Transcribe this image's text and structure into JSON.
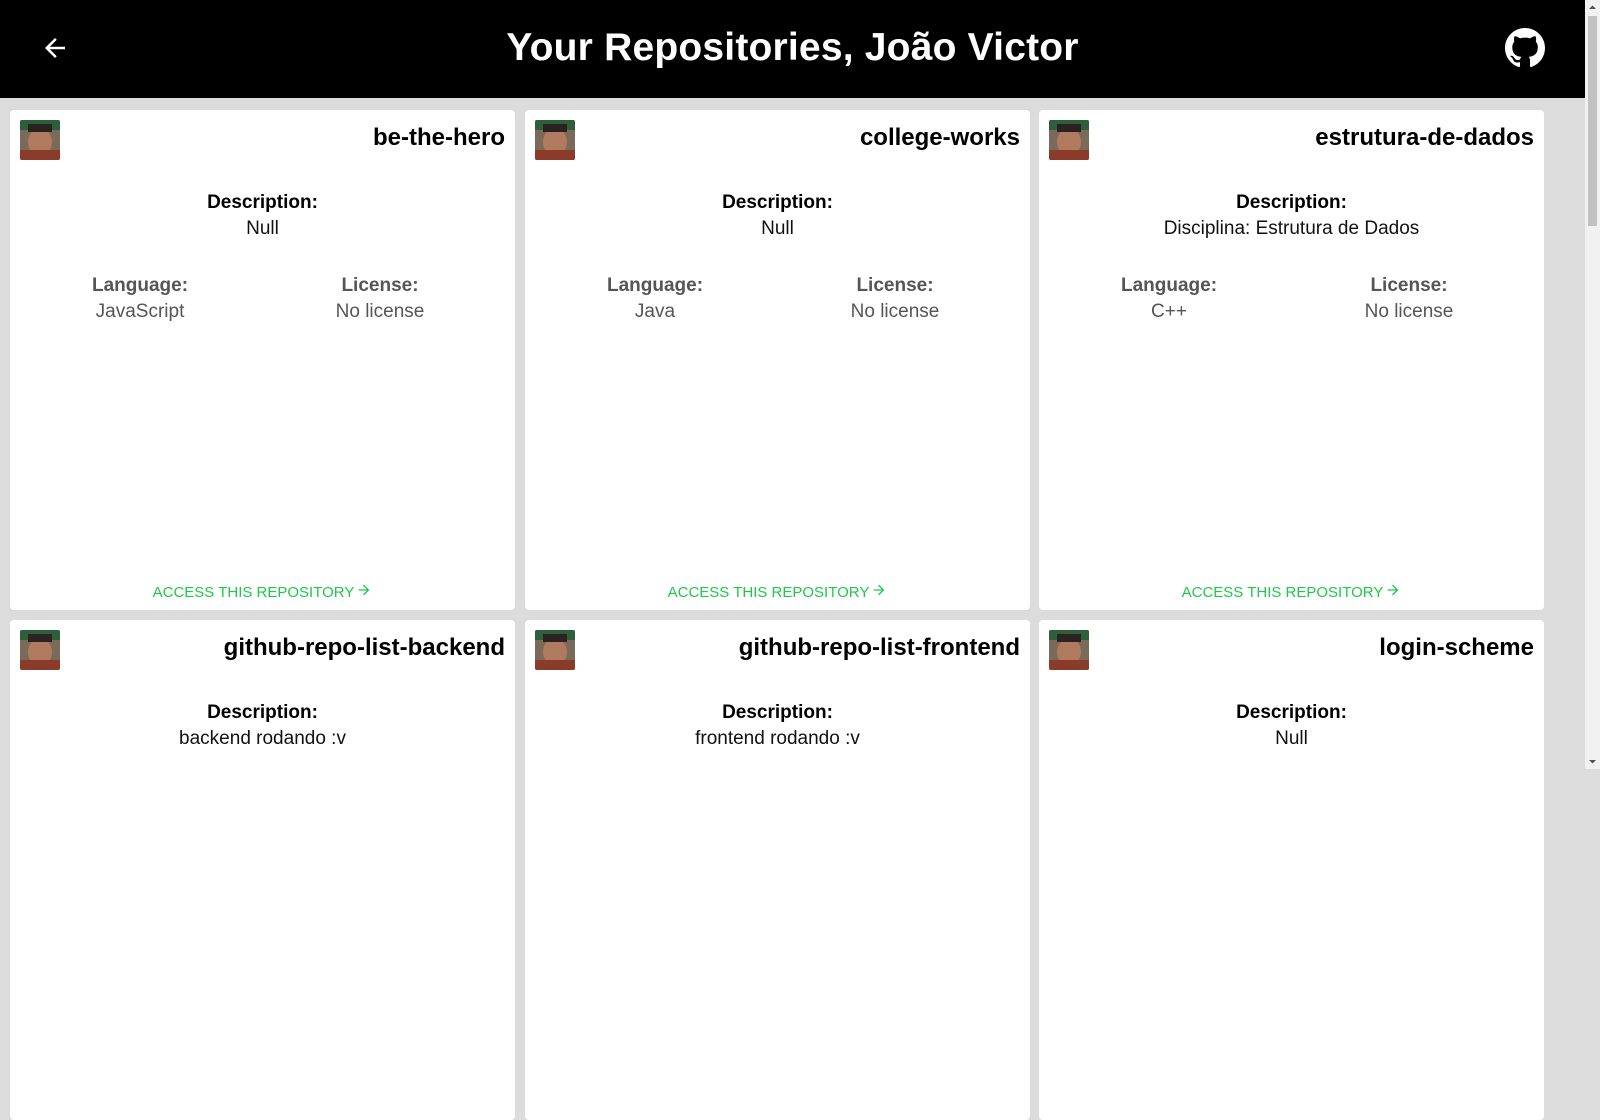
{
  "header": {
    "title": "Your Repositories, João Victor",
    "back_icon": "arrow-left-icon",
    "github_icon": "github-icon"
  },
  "access_label": "ACCESS THIS REPOSITORY",
  "labels": {
    "description": "Description:",
    "language": "Language:",
    "license": "License:"
  },
  "colors": {
    "topbar": "#000000",
    "background": "#dcdcdc",
    "accent": "#1ec94a"
  },
  "repos": [
    {
      "name": "be-the-hero",
      "description": "Null",
      "language": "JavaScript",
      "license": "No license"
    },
    {
      "name": "college-works",
      "description": "Null",
      "language": "Java",
      "license": "No license"
    },
    {
      "name": "estrutura-de-dados",
      "description": "Disciplina: Estrutura de Dados",
      "language": "C++",
      "license": "No license"
    },
    {
      "name": "github-repo-list-backend",
      "description": "backend rodando :v",
      "language": "",
      "license": ""
    },
    {
      "name": "github-repo-list-frontend",
      "description": "frontend rodando :v",
      "language": "",
      "license": ""
    },
    {
      "name": "login-scheme",
      "description": "Null",
      "language": "",
      "license": ""
    }
  ]
}
